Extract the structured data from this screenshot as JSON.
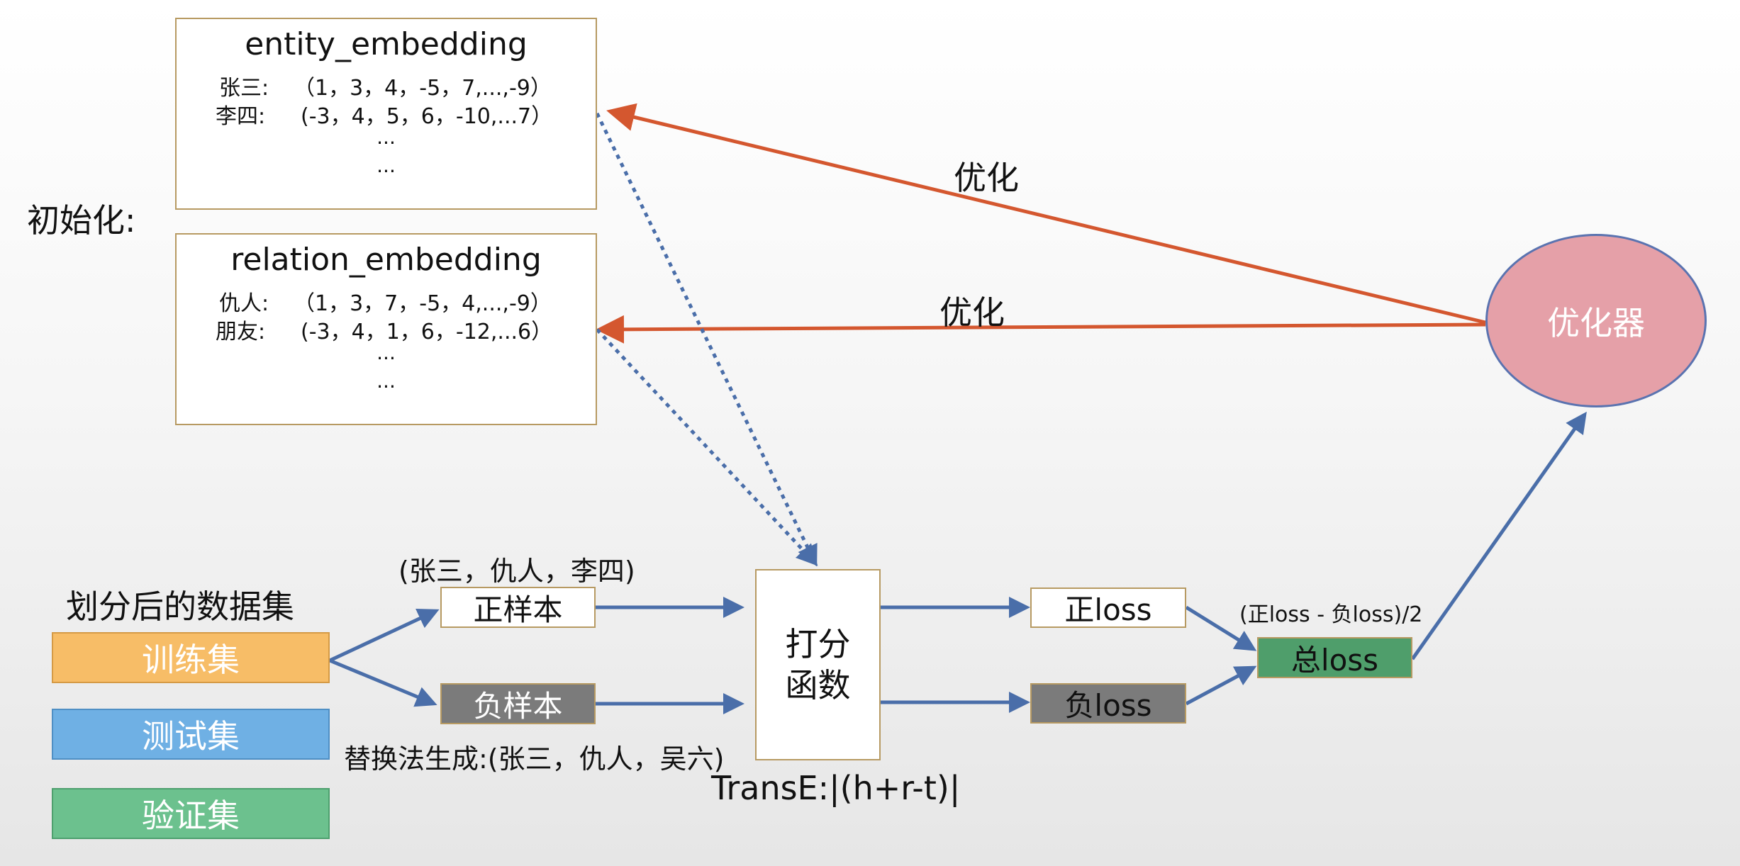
{
  "init_label": "初始化:",
  "entity_embedding": {
    "title": "entity_embedding",
    "rows": [
      {
        "name": "张三:",
        "vector": "（1，3，4，-5，7,...,-9）"
      },
      {
        "name": "李四:",
        "vector": "(-3，4，5，6，-10,...7）"
      }
    ],
    "dots": [
      "...",
      "..."
    ]
  },
  "relation_embedding": {
    "title": "relation_embedding",
    "rows": [
      {
        "name": "仇人:",
        "vector": "（1，3，7，-5，4,...,-9）"
      },
      {
        "name": "朋友:",
        "vector": "(-3，4，1，6，-12,...6）"
      }
    ],
    "dots": [
      "...",
      "..."
    ]
  },
  "dataset": {
    "title": "划分后的数据集",
    "train": "训练集",
    "test": "测试集",
    "valid": "验证集"
  },
  "samples": {
    "positive_example": "(张三，仇人，李四)",
    "positive": "正样本",
    "negative": "负样本",
    "negative_example": "替换法生成:(张三，仇人，吴六)"
  },
  "score": {
    "line1": "打分",
    "line2": "函数",
    "formula": "TransE:|(h+r-t)|"
  },
  "loss": {
    "pos": "正loss",
    "neg": "负loss",
    "total": "总loss",
    "formula": "(正loss - 负loss)/2"
  },
  "optimizer": {
    "label": "优化器",
    "arrow_label_entity": "优化",
    "arrow_label_relation": "优化"
  },
  "colors": {
    "optimize_arrow": "#d4572f",
    "flow_arrow": "#4a6ea9",
    "train": "#f7bd67",
    "test": "#6fb0e4",
    "valid": "#6cc18e",
    "negative_box": "#7b7b7b",
    "total_loss": "#4f9e6b",
    "optimizer": "#e5a0a8"
  }
}
